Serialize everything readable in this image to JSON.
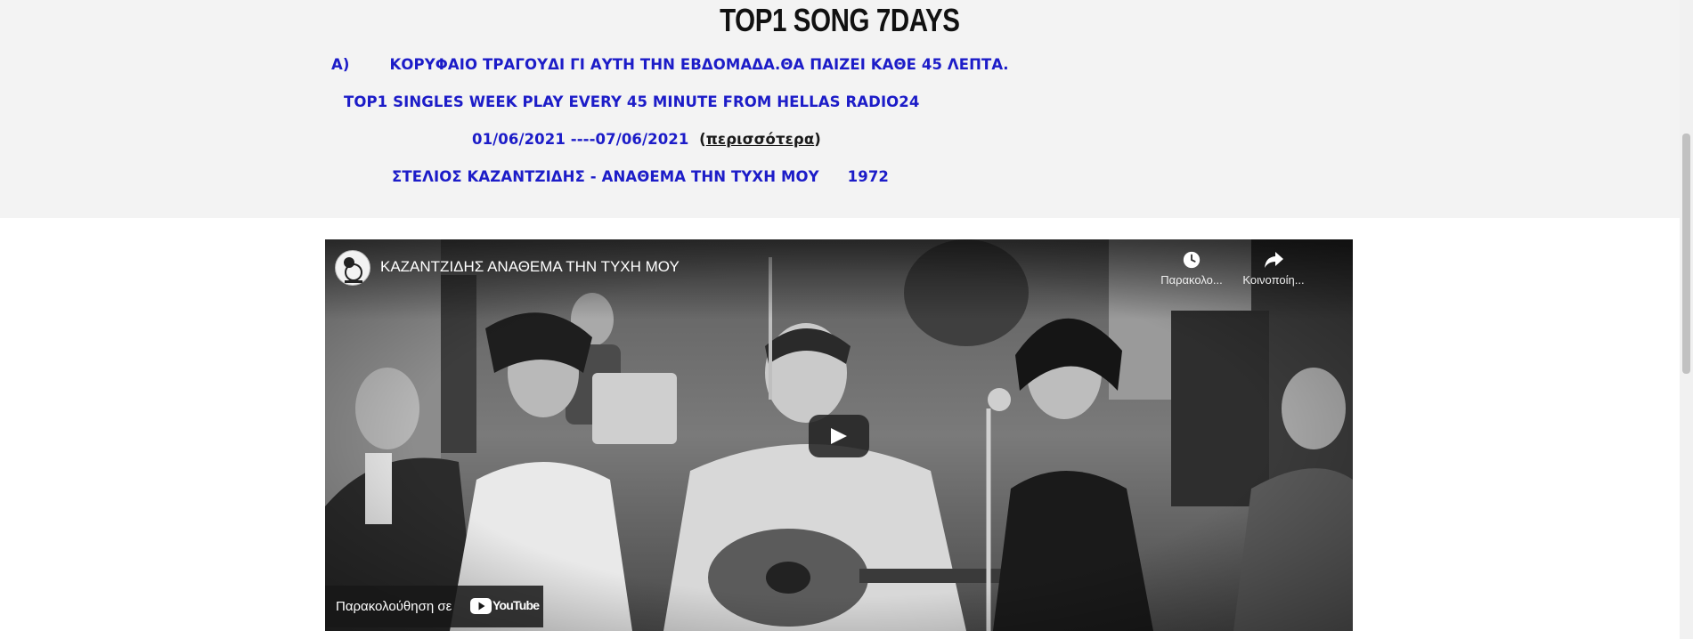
{
  "header": {
    "title": "TOP1 SONG  7DAYS",
    "line1_prefix": "A)",
    "line1_text": "ΚΟΡΥΦΑΙΟ ΤΡΑΓΟΥΔΙ ΓΙ ΑΥΤΗ ΤΗΝ ΕΒΔΟΜΑΔΑ.ΘΑ ΠΑΙΖΕΙ ΚΑΘΕ 45 ΛΕΠΤΑ.",
    "line2_text": "TOP1 SINGLES WEEK PLAY EVERY 45 MINUTE FROM HELLAS RADIO24",
    "date_range": "01/06/2021 ----07/06/2021",
    "more_link": "περισσότερα",
    "song": "ΣΤΕΛΙΟΣ ΚΑΖΑΝΤΖΙΔΗΣ - ΑΝΑΘΕΜΑ ΤΗΝ ΤΥΧΗ ΜΟΥ",
    "year": "1972"
  },
  "video": {
    "title": "ΚΑΖΑΝΤΖΙΔΗΣ ΑΝΑΘΕΜΑ ΤΗΝ ΤΥΧΗ ΜΟΥ",
    "watch_later_label": "Παρακολο...",
    "share_label": "Κοινοποίη...",
    "watch_on_label": "Παρακολούθηση σε",
    "youtube_wordmark": "YouTube",
    "icons": [
      "channel-avatar-icon",
      "clock-icon",
      "share-icon",
      "play-icon",
      "youtube-logo-icon"
    ],
    "colors": {
      "play_bg": "#212121",
      "youtube_red": "#ff0000"
    }
  },
  "colors": {
    "text_blue": "#1c1cc8",
    "header_bg": "#f3f3f3",
    "title": "#111111"
  }
}
